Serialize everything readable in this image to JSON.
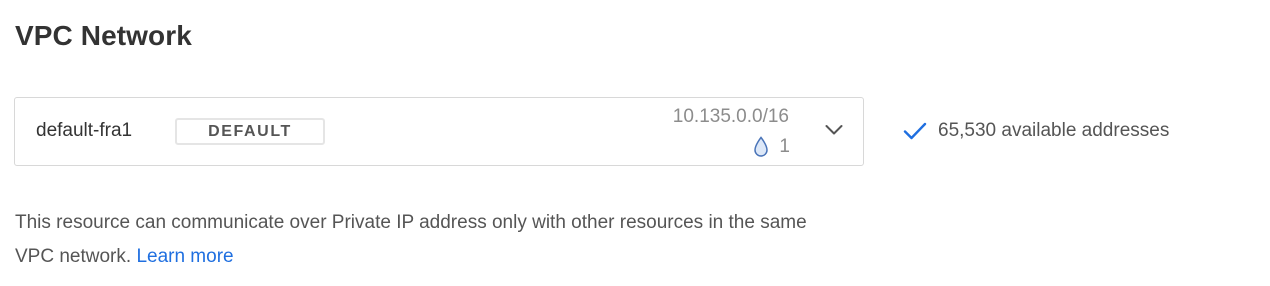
{
  "section": {
    "title": "VPC Network"
  },
  "vpc": {
    "name": "default-fra1",
    "badge": "DEFAULT",
    "ip_range": "10.135.0.0/16",
    "droplet_count": "1",
    "droplet_icon": "droplet-icon",
    "chevron_icon": "chevron-down-icon"
  },
  "availability": {
    "icon": "check-icon",
    "text": "65,530 available addresses",
    "icon_color": "#1f6fe0"
  },
  "help": {
    "text_before": "This resource can communicate over Private IP address only with other resources in the same VPC network.",
    "link_label": "Learn more",
    "link_color": "#1f6fe0"
  }
}
